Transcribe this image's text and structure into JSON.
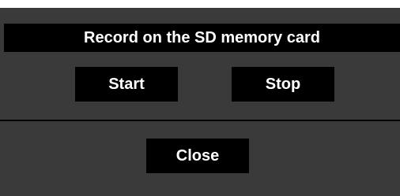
{
  "dialog": {
    "title": "Record on the SD memory card",
    "buttons": {
      "start_label": "Start",
      "stop_label": "Stop",
      "close_label": "Close"
    }
  },
  "colors": {
    "panel_background": "#3a3a3a",
    "button_background": "#000000",
    "text": "#ffffff"
  }
}
